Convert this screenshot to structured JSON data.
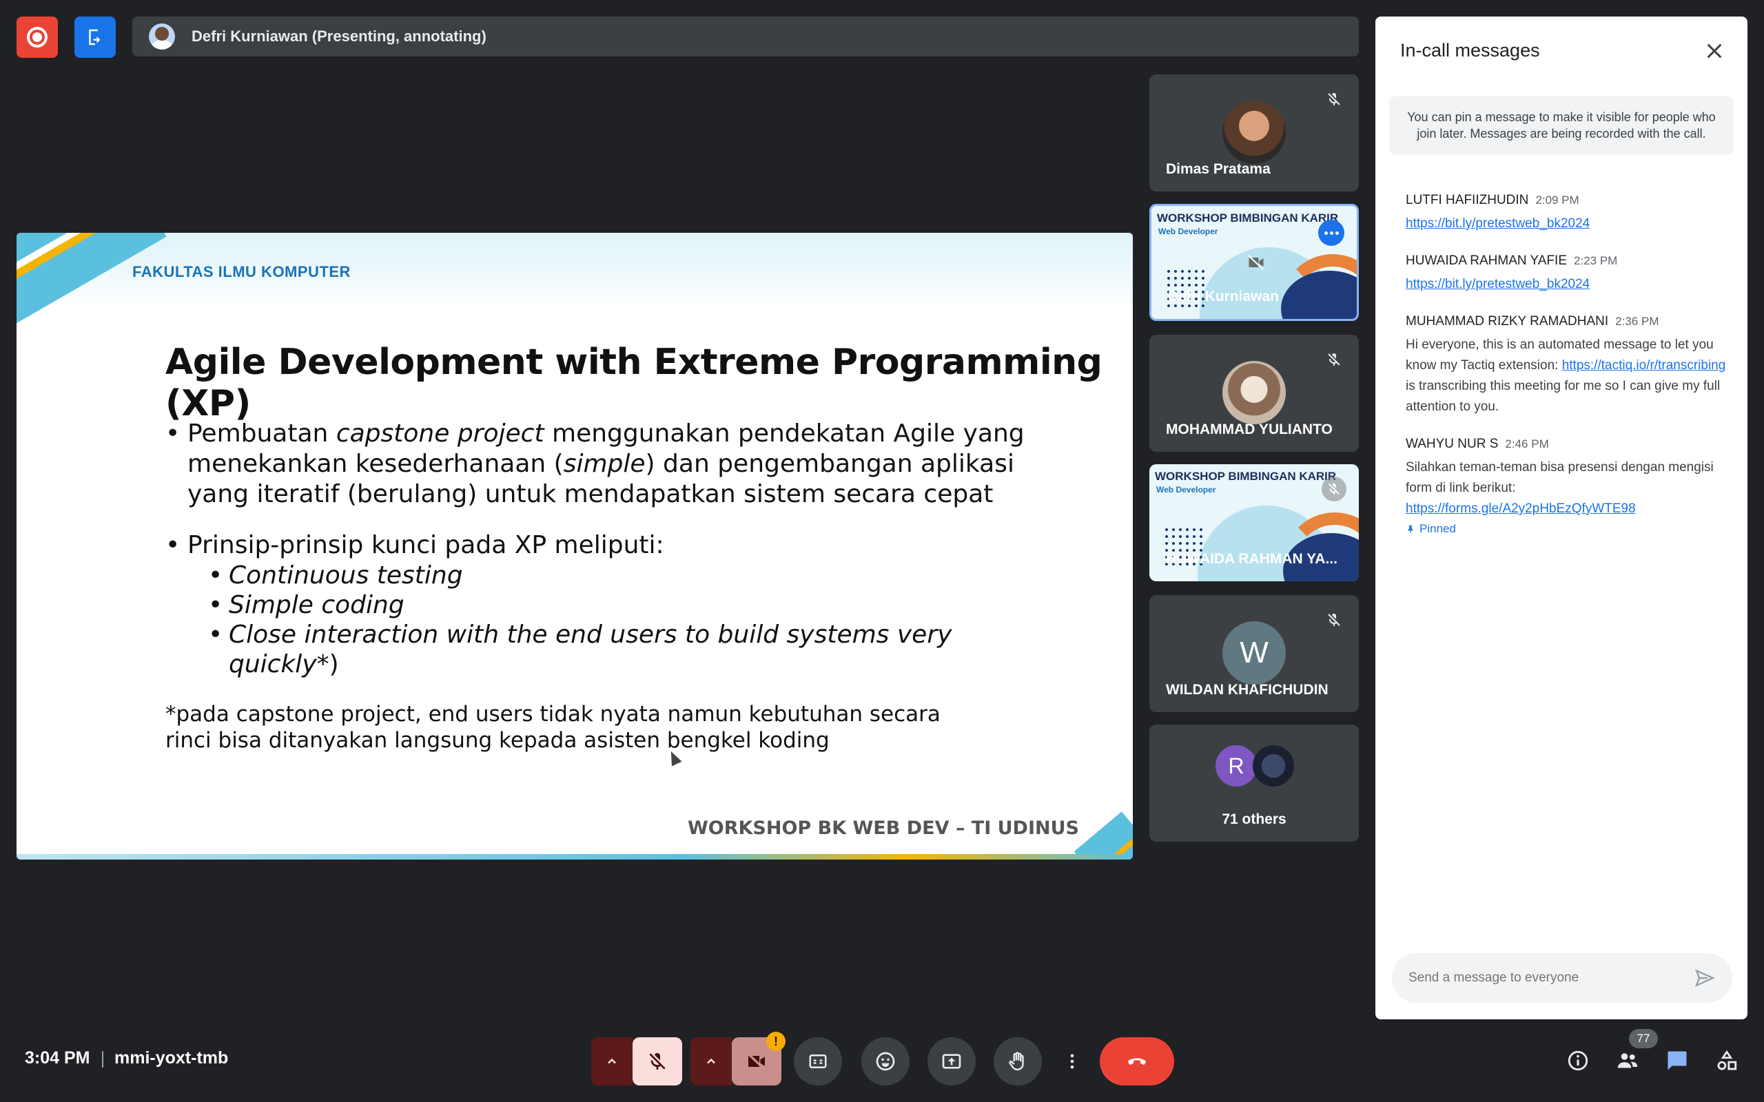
{
  "header": {
    "presenter": "Defri Kurniawan (Presenting, annotating)"
  },
  "slide": {
    "faculty": "FAKULTAS ILMU KOMPUTER",
    "title": "Agile Development with Extreme Programming (XP)",
    "bullet1": {
      "p1": "Pembuatan ",
      "p2": "capstone project",
      "p3": " menggunakan pendekatan Agile yang menekankan kesederhanaan (",
      "p4": "simple",
      "p5": ") dan pengembangan aplikasi yang iteratif (berulang) untuk mendapatkan sistem secara cepat"
    },
    "bullet2": "Prinsip-prinsip kunci pada XP meliputi:",
    "subs": [
      "Continuous testing",
      "Simple coding",
      "Close interaction with the end users to build systems very quickly"
    ],
    "sub3_suffix": "*)",
    "note": " *pada capstone project, end users tidak nyata namun kebutuhan secara rinci bisa ditanyakan langsung kepada asisten bengkel koding",
    "footer": "WORKSHOP BK WEB DEV – TI UDINUS"
  },
  "tiles": [
    {
      "name": "Dimas Pratama"
    },
    {
      "name": "Defri Kurniawan",
      "slide_title": "WORKSHOP BIMBINGAN KARIR",
      "slide_sub": "Web Developer"
    },
    {
      "name": "MOHAMMAD YULIANTO"
    },
    {
      "name": "HUWAIDA RAHMAN YA...",
      "slide_title": "WORKSHOP BIMBINGAN KARIR",
      "slide_sub": "Web Developer"
    },
    {
      "name": "WILDAN KHAFICHUDIN",
      "initial": "W"
    },
    {
      "name": "71 others",
      "initial": "R"
    }
  ],
  "chat": {
    "title": "In-call messages",
    "pin_info": "You can pin a message to make it visible for people who join later. Messages are being recorded with the call.",
    "messages": [
      {
        "sender": "LUTFI HAFIIZHUDIN",
        "time": "2:09 PM",
        "link": "https://bit.ly/pretestweb_bk2024"
      },
      {
        "sender": "HUWAIDA RAHMAN YAFIE",
        "time": "2:23 PM",
        "link": "https://bit.ly/pretestweb_bk2024"
      },
      {
        "sender": "MUHAMMAD RIZKY RAMADHANI",
        "time": "2:36 PM",
        "text1": "Hi everyone, this is an automated message to let you know my Tactiq extension: ",
        "link": "https://tactiq.io/r/transcribing",
        "text2": " is transcribing this meeting for me so I can give my full attention to you."
      },
      {
        "sender": "WAHYU NUR S",
        "time": "2:46 PM",
        "text1": "Silahkan teman-teman bisa presensi dengan mengisi form di link berikut: ",
        "link": "https://forms.gle/A2y2pHbEzQfyWTE98",
        "pinned": "Pinned"
      }
    ],
    "input_placeholder": "Send a message to everyone"
  },
  "footer": {
    "time": "3:04 PM",
    "meeting_code": "mmi-yoxt-tmb",
    "camera_warning": "!",
    "participants_count": "77"
  },
  "colors": {
    "accent": "#1a73e8",
    "end_call": "#ea4335",
    "background": "#202124"
  }
}
